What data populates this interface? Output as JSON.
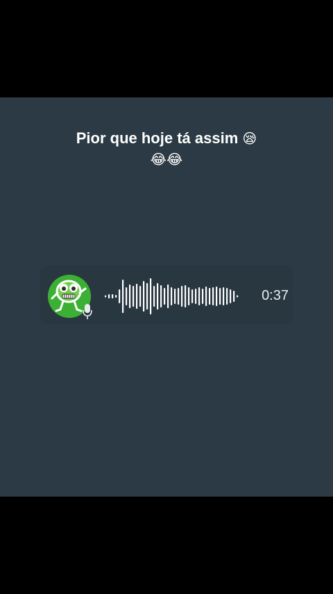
{
  "caption": {
    "line1": "Pior que hoje tá assim",
    "line1_emoji": "😪",
    "line2_emoji": "😂😂"
  },
  "voice_message": {
    "duration": "0:37",
    "avatar_icon": "green-cartoon-character-icon",
    "mic_icon": "microphone-icon",
    "accent_color": "#3cb034"
  }
}
